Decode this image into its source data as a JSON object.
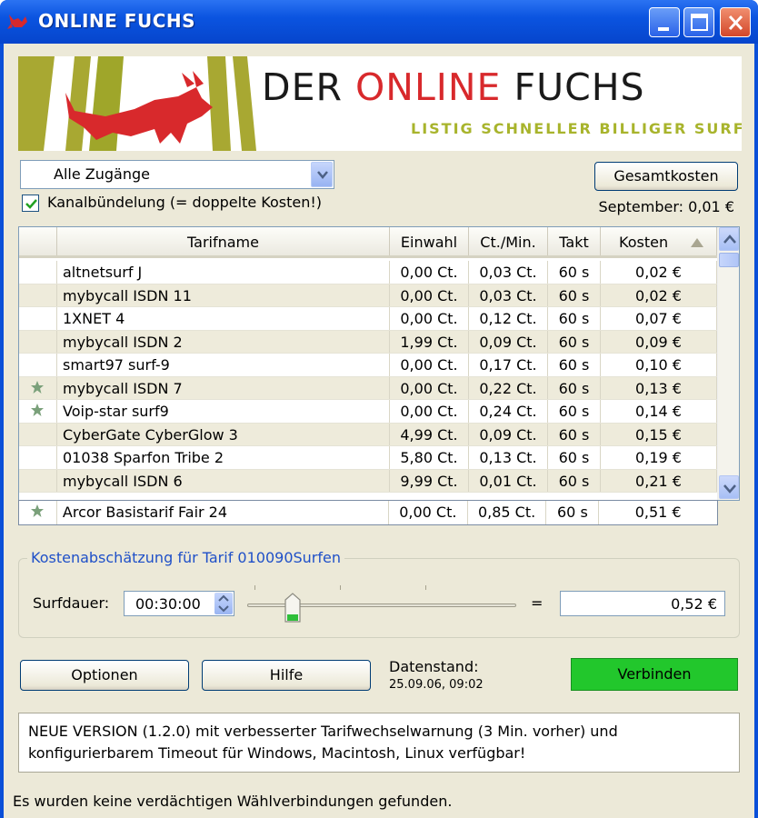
{
  "window": {
    "title": "ONLINE FUCHS"
  },
  "banner": {
    "title_part1": "DER ",
    "title_red": "ONLINE",
    "title_part2": " FUCHS",
    "subtitle": "LISTIG SCHNELLER BILLIGER SURFEN"
  },
  "access": {
    "selected": "Alle Zugänge"
  },
  "bundling": {
    "checked": true,
    "label": "Kanalbündelung (= doppelte Kosten!)"
  },
  "totals": {
    "button_label": "Gesamtkosten",
    "month_text": "September: 0,01 €"
  },
  "table": {
    "columns": [
      "",
      "Tarifname",
      "Einwahl",
      "Ct./Min.",
      "Takt",
      "Kosten"
    ],
    "sort_column": "Kosten",
    "rows": [
      {
        "star": false,
        "name": "altnetsurf J",
        "einwahl": "0,00 Ct.",
        "ctmin": "0,03 Ct.",
        "takt": "60 s",
        "kosten": "0,02 €"
      },
      {
        "star": false,
        "name": "mybycall ISDN 11",
        "einwahl": "0,00 Ct.",
        "ctmin": "0,03 Ct.",
        "takt": "60 s",
        "kosten": "0,02 €"
      },
      {
        "star": false,
        "name": "1XNET 4",
        "einwahl": "0,00 Ct.",
        "ctmin": "0,12 Ct.",
        "takt": "60 s",
        "kosten": "0,07 €"
      },
      {
        "star": false,
        "name": "mybycall ISDN 2",
        "einwahl": "1,99 Ct.",
        "ctmin": "0,09 Ct.",
        "takt": "60 s",
        "kosten": "0,09 €"
      },
      {
        "star": false,
        "name": "smart97 surf-9",
        "einwahl": "0,00 Ct.",
        "ctmin": "0,17 Ct.",
        "takt": "60 s",
        "kosten": "0,10 €"
      },
      {
        "star": true,
        "name": "mybycall ISDN 7",
        "einwahl": "0,00 Ct.",
        "ctmin": "0,22 Ct.",
        "takt": "60 s",
        "kosten": "0,13 €"
      },
      {
        "star": true,
        "name": "Voip-star surf9",
        "einwahl": "0,00 Ct.",
        "ctmin": "0,24 Ct.",
        "takt": "60 s",
        "kosten": "0,14 €"
      },
      {
        "star": false,
        "name": "CyberGate CyberGlow 3",
        "einwahl": "4,99 Ct.",
        "ctmin": "0,09 Ct.",
        "takt": "60 s",
        "kosten": "0,15 €"
      },
      {
        "star": false,
        "name": "01038 Sparfon Tribe 2",
        "einwahl": "5,80 Ct.",
        "ctmin": "0,13 Ct.",
        "takt": "60 s",
        "kosten": "0,19 €"
      },
      {
        "star": false,
        "name": "mybycall ISDN 6",
        "einwahl": "9,99 Ct.",
        "ctmin": "0,01 Ct.",
        "takt": "60 s",
        "kosten": "0,21 €"
      }
    ],
    "pinned_row": {
      "star": true,
      "name": "Arcor Basistarif Fair 24",
      "einwahl": "0,00 Ct.",
      "ctmin": "0,85 Ct.",
      "takt": "60 s",
      "kosten": "0,51 €"
    }
  },
  "estimate": {
    "group_title": "Kostenabschätzung für Tarif 010090Surfen",
    "duration_label": "Surfdauer:",
    "duration_value": "00:30:00",
    "slider_fraction": 0.17,
    "equals": "=",
    "result": "0,52 €"
  },
  "actions": {
    "options_label": "Optionen",
    "help_label": "Hilfe",
    "data_label": "Datenstand:",
    "data_date": "25.09.06, 09:02",
    "connect_label": "Verbinden"
  },
  "news": {
    "line1": "NEUE VERSION (1.2.0) mit verbesserter Tarifwechselwarnung (3 Min. vorher) und",
    "line2": "konfigurierbarem Timeout für Windows, Macintosh, Linux verfügbar!"
  },
  "status": "Es wurden keine verdächtigen Wählverbindungen gefunden.",
  "colors": {
    "title_blue": "#0b54e0",
    "brand_red": "#d8292c",
    "brand_green": "#a8b42c",
    "connect_green": "#22c72c",
    "group_title_blue": "#1f50c8"
  }
}
